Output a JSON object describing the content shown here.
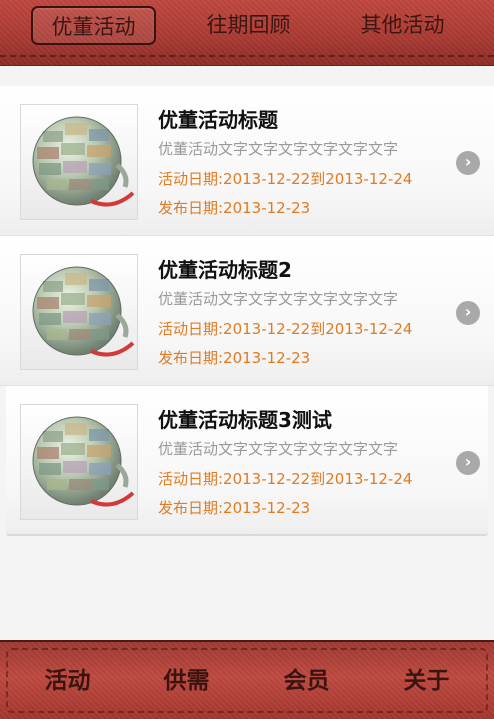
{
  "top_tabs": [
    {
      "label": "优董活动",
      "active": true
    },
    {
      "label": "往期回顾",
      "active": false
    },
    {
      "label": "其他活动",
      "active": false
    }
  ],
  "items": [
    {
      "title": "优董活动标题",
      "desc": "优董活动文字文字文字文字文字文字",
      "event_date": "活动日期:2013-12-22到2013-12-24",
      "publish_date": "发布日期:2013-12-23"
    },
    {
      "title": "优董活动标题2",
      "desc": "优董活动文字文字文字文字文字文字",
      "event_date": "活动日期:2013-12-22到2013-12-24",
      "publish_date": "发布日期:2013-12-23"
    },
    {
      "title": "优董活动标题3测试",
      "desc": "优董活动文字文字文字文字文字文字",
      "event_date": "活动日期:2013-12-22到2013-12-24",
      "publish_date": "发布日期:2013-12-23"
    }
  ],
  "bottom_nav": [
    {
      "label": "活动"
    },
    {
      "label": "供需"
    },
    {
      "label": "会员"
    },
    {
      "label": "关于"
    }
  ],
  "icons": {
    "thumbnail": "globe-money-image",
    "item_arrow": "chevron-right-icon"
  },
  "colors": {
    "leather_red": "#b3423a",
    "date_orange": "#e07b22",
    "desc_gray": "#9a9a9a",
    "arrow_gray": "#a9a9a9"
  }
}
